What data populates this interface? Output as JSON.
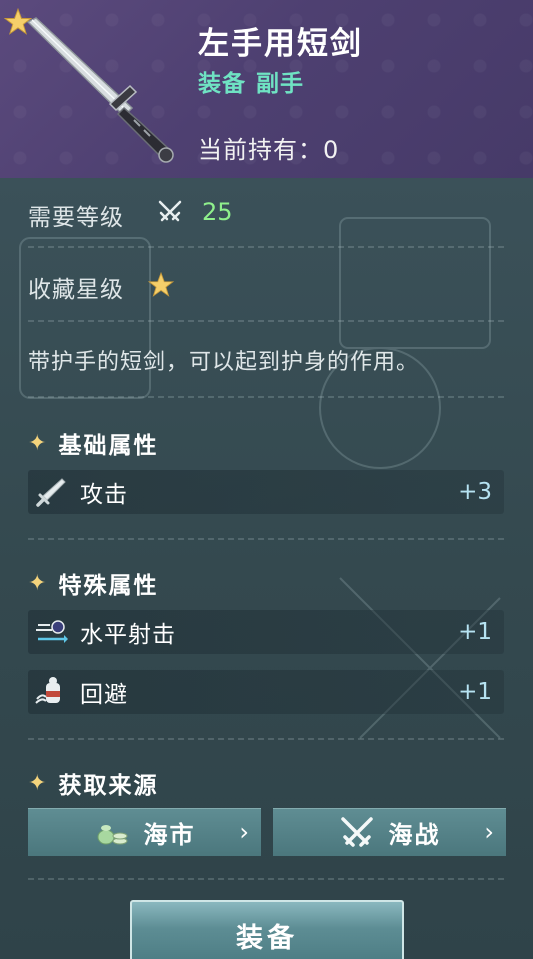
{
  "item": {
    "name": "左手用短剑",
    "type_category": "装备",
    "type_slot": "副手",
    "holding_label": "当前持有：",
    "holding_count": "0"
  },
  "requirements": {
    "level_label": "需要等级",
    "level_icon": "crossed-swords-icon",
    "level_value": "25",
    "collect_label": "收藏星级",
    "collect_stars": 1
  },
  "description": "带护手的短剑，可以起到护身的作用。",
  "basic_stats": {
    "title": "基础属性",
    "items": [
      {
        "icon": "sword-icon",
        "label": "攻击",
        "value": "+3"
      }
    ]
  },
  "special_stats": {
    "title": "特殊属性",
    "items": [
      {
        "icon": "horizontal-shot-icon",
        "label": "水平射击",
        "value": "+1"
      },
      {
        "icon": "evade-icon",
        "label": "回避",
        "value": "+1"
      }
    ]
  },
  "sources": {
    "title": "获取来源",
    "items": [
      {
        "icon": "coin-bag-icon",
        "label": "海市"
      },
      {
        "icon": "crossed-swords-icon",
        "label": "海战"
      }
    ]
  },
  "actions": {
    "equip_label": "装备"
  },
  "colors": {
    "header_bg": "#4e4071",
    "panel_bg": "#34494f",
    "type_text": "#6fe3c3",
    "level_value": "#8ff08c",
    "stat_value": "#b6e3f2",
    "section_spark": "#f4d47c"
  }
}
